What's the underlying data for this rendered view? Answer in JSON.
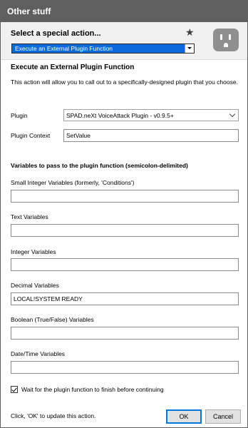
{
  "window": {
    "title": "Other stuff"
  },
  "header": {
    "select_label": "Select a special action...",
    "selected_action": "Execute an External Plugin Function",
    "star_icon": "star-icon",
    "plug_icon": "power-outlet-icon"
  },
  "section": {
    "title": "Execute an External Plugin Function",
    "description": "This action will allow you to call out to a specifically-designed plugin that you choose."
  },
  "plugin": {
    "label": "Plugin",
    "value": "SPAD.neXt VoiceAttack Plugin - v0.9.5+"
  },
  "plugin_context": {
    "label": "Plugin Context",
    "value": "SetValue"
  },
  "variables": {
    "title": "Variables to pass to the plugin function (semicolon-delimited)",
    "small_integer": {
      "label": "Small Integer Variables (formerly, 'Conditions')",
      "value": ""
    },
    "text": {
      "label": "Text Variables",
      "value": ""
    },
    "integer": {
      "label": "Integer Variables",
      "value": ""
    },
    "decimal": {
      "label": "Decimal Variables",
      "value": "LOCAL!SYSTEM READY"
    },
    "boolean": {
      "label": "Boolean (True/False) Variables",
      "value": ""
    },
    "datetime": {
      "label": "Date/Time Variables",
      "value": ""
    }
  },
  "wait": {
    "label": "Wait for the plugin function to finish before continuing",
    "checked": true
  },
  "footer": {
    "hint": "Click, 'OK' to update this action.",
    "ok_label": "OK",
    "cancel_label": "Cancel"
  }
}
